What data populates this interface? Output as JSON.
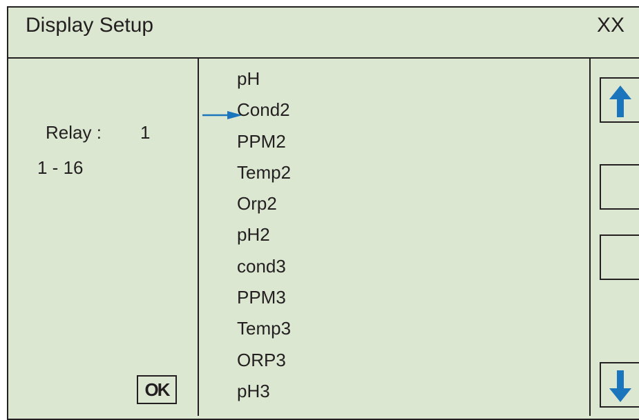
{
  "header": {
    "title": "Display Setup",
    "corner_text": "XX"
  },
  "relay": {
    "label": "Relay :",
    "value": "1",
    "range": "1 - 16"
  },
  "ok_button": {
    "label": "OK"
  },
  "list": {
    "items": [
      "pH",
      "Cond2",
      "PPM2",
      "Temp2",
      "Orp2",
      "pH2",
      "cond3",
      "PPM3",
      "Temp3",
      "ORP3",
      "pH3"
    ],
    "selected_item": "Cond2"
  },
  "icons": {
    "pointer": "arrow-right-icon",
    "scroll_up": "arrow-up-icon",
    "scroll_down": "arrow-down-icon"
  },
  "colors": {
    "background": "#dbe7d1",
    "accent": "#1b75bc",
    "ink": "#231f20"
  }
}
